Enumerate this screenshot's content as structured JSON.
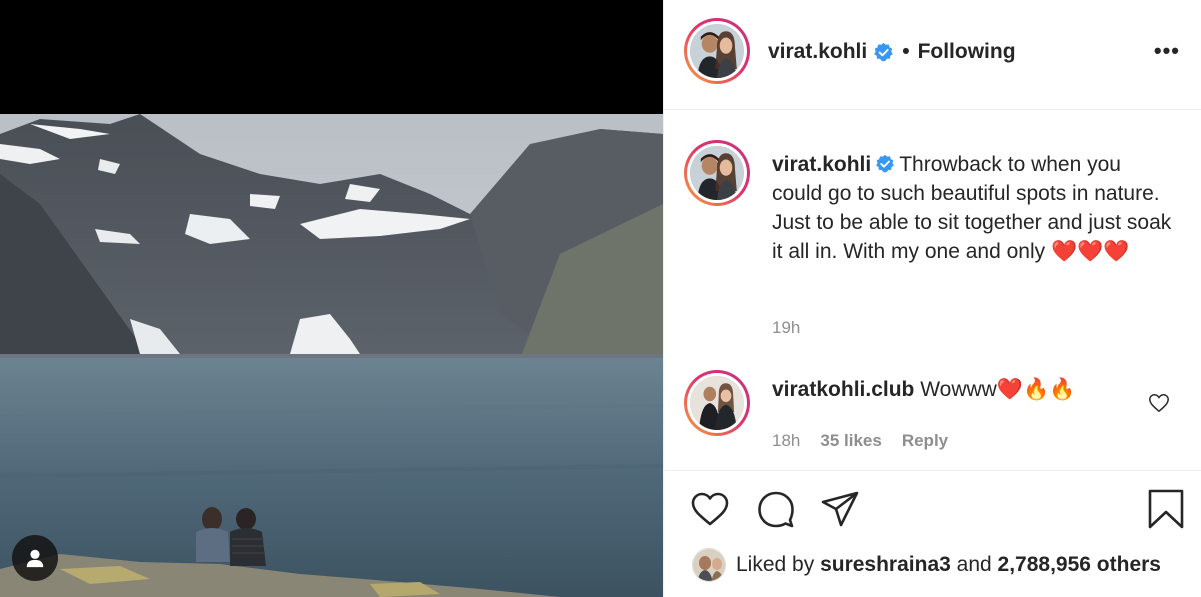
{
  "post": {
    "username": "virat.kohli",
    "separator": "•",
    "follow_status": "Following",
    "more_label": "•••"
  },
  "caption": {
    "username": "virat.kohli",
    "text": "Throwback to when you could go to such beautiful spots in nature. Just to be able to sit together and just soak it all in. With my one and only",
    "emojis": "❤️❤️❤️",
    "time": "19h"
  },
  "comment": {
    "username": "viratkohli.club",
    "text": "Wowww❤️🔥🔥",
    "time": "18h",
    "likes": "35 likes",
    "reply": "Reply"
  },
  "likes": {
    "prefix": "Liked by",
    "liker": "sureshraina3",
    "connector": "and",
    "others": "2,788,956 others"
  },
  "icons": {
    "like": "heart-icon",
    "comment": "comment-icon",
    "share": "share-icon",
    "save": "bookmark-icon",
    "tag": "user-tag-icon",
    "verified": "verified-badge-icon"
  },
  "colors": {
    "verified": "#3897f0",
    "muted": "#8e8e8e",
    "text": "#262626",
    "ring_start": "#f9a23c",
    "ring_end": "#c13584"
  }
}
